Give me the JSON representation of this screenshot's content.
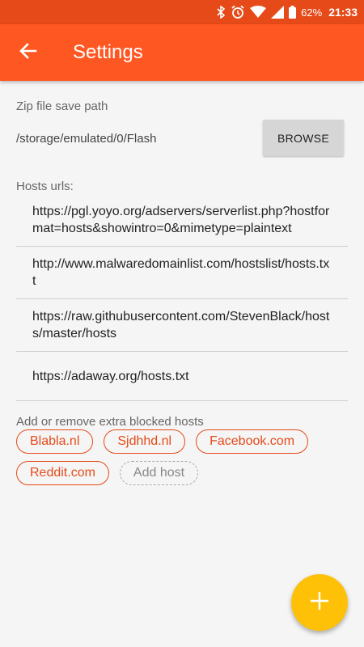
{
  "status_bar": {
    "battery": "62%",
    "time": "21:33",
    "icons": [
      "bluetooth-icon",
      "alarm-icon",
      "wifi-icon",
      "signal-icon",
      "battery-icon"
    ]
  },
  "app_bar": {
    "title": "Settings",
    "back_icon": "arrow-back-icon",
    "color": "#ff5722"
  },
  "zip": {
    "label": "Zip file save path",
    "path": "/storage/emulated/0/Flash",
    "browse_label": "BROWSE"
  },
  "hosts": {
    "label": "Hosts urls:",
    "urls": [
      "https://pgl.yoyo.org/adservers/serverlist.php?hostformat=hosts&showintro=0&mimetype=plaintext",
      "http://www.malwaredomainlist.com/hostslist/hosts.txt",
      "https://raw.githubusercontent.com/StevenBlack/hosts/master/hosts",
      "https://adaway.org/hosts.txt"
    ]
  },
  "extra_hosts": {
    "label": "Add or remove extra blocked hosts",
    "chips": [
      "Blabla.nl",
      "Sjdhhd.nl",
      "Facebook.com",
      "Reddit.com"
    ],
    "add_label": "Add host"
  },
  "fab": {
    "icon": "plus-icon",
    "color": "#ffc107"
  }
}
